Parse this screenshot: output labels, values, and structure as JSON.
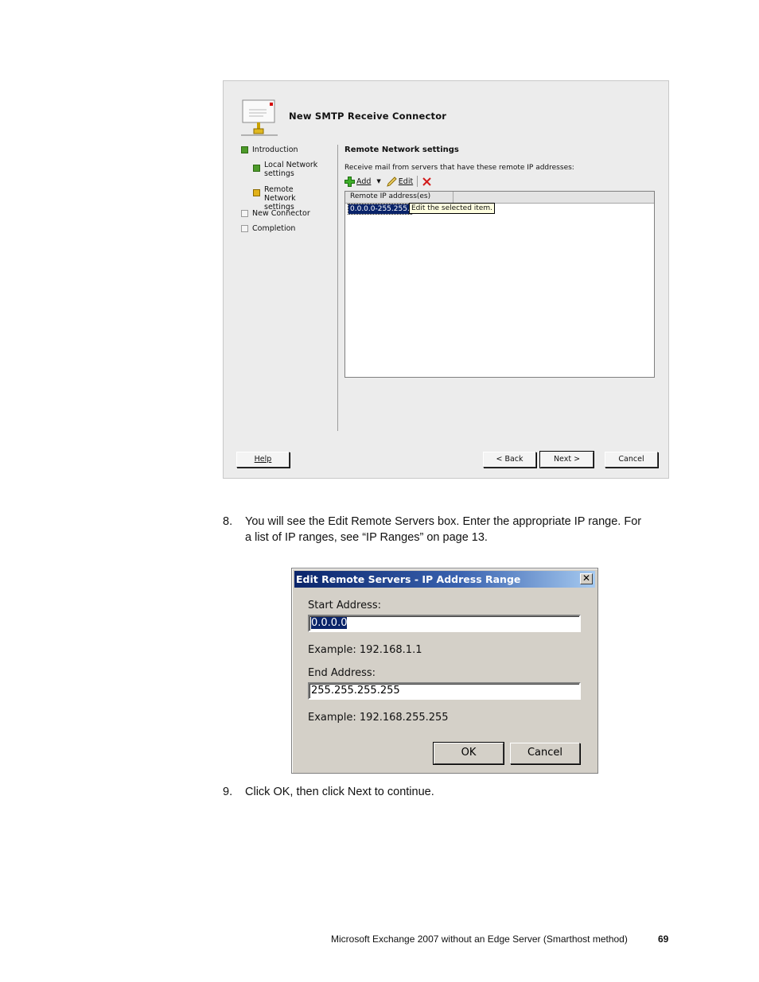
{
  "wizard": {
    "title": "New SMTP Receive Connector",
    "nav": [
      {
        "label": "Introduction",
        "state": "done"
      },
      {
        "label": "Local Network settings",
        "state": "done"
      },
      {
        "label": "Remote Network settings",
        "state": "current"
      },
      {
        "label": "New Connector",
        "state": "pending"
      },
      {
        "label": "Completion",
        "state": "pending"
      }
    ],
    "section_title": "Remote Network settings",
    "section_desc": "Receive mail from servers that have these remote IP addresses:",
    "toolbar": {
      "add_label": "Add",
      "edit_label": "Edit"
    },
    "list": {
      "column_header": "Remote IP address(es)",
      "selected_row": "0.0.0.0-255.255.",
      "tooltip": "Edit the selected item."
    },
    "buttons": {
      "help": "Help",
      "back": "< Back",
      "next": "Next >",
      "cancel": "Cancel"
    }
  },
  "steps": [
    {
      "number": "8.",
      "text_line1": "You will see the Edit Remote Servers box. Enter the appropriate IP range. For",
      "text_line2": "a list of IP ranges, see “IP Ranges” on page 13."
    },
    {
      "number": "9.",
      "text_line1": "Click OK, then click Next to continue."
    }
  ],
  "dialog": {
    "title": "Edit Remote Servers - IP Address Range",
    "close": "✕",
    "start_label": "Start Address:",
    "start_value": "0.0.0.0",
    "start_example": "Example: 192.168.1.1",
    "end_label": "End Address:",
    "end_value": "255.255.255.255",
    "end_example": "Example: 192.168.255.255",
    "ok": "OK",
    "cancel": "Cancel"
  },
  "footer": {
    "text": "Microsoft Exchange 2007 without an Edge Server (Smarthost method)",
    "page_number": "69"
  },
  "colors": {
    "selection": "#0a246a",
    "titlebar_start": "#0a246a",
    "titlebar_end": "#a6caf0"
  }
}
